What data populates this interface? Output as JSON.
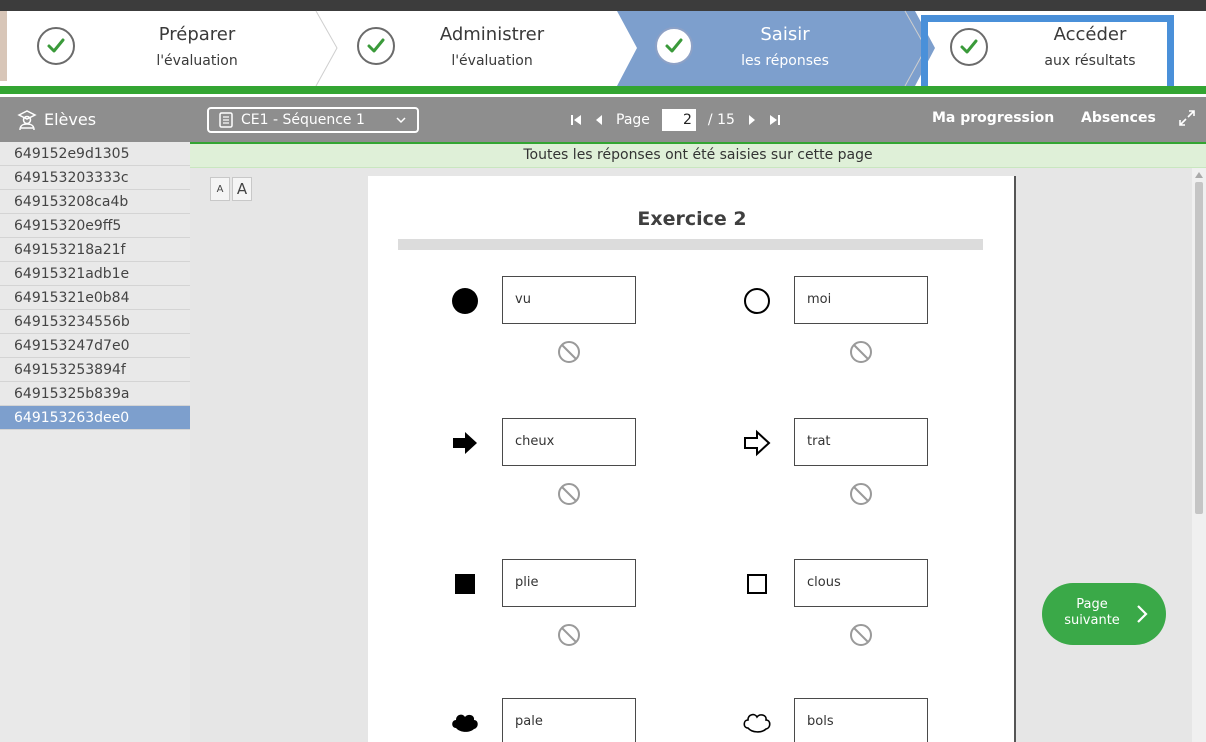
{
  "wizard": {
    "steps": [
      {
        "title": "Préparer",
        "subtitle": "l'évaluation",
        "state": "done"
      },
      {
        "title": "Administrer",
        "subtitle": "l'évaluation",
        "state": "done"
      },
      {
        "title": "Saisir",
        "subtitle": "les réponses",
        "state": "current"
      },
      {
        "title": "Accéder",
        "subtitle": "aux résultats",
        "state": "done"
      }
    ],
    "highlighted_step": "Accéder",
    "colors": {
      "current_step": "#7d9fcd",
      "progress_bar": "#33a532",
      "highlight_border": "#4a90d9"
    }
  },
  "sidebar": {
    "title": "Elèves",
    "icon": "student-icon",
    "students": [
      "649152e9d1305",
      "649153203333c",
      "649153208ca4b",
      "64915320e9ff5",
      "649153218a21f",
      "64915321adb1e",
      "64915321e0b84",
      "649153234556b",
      "649153247d7e0",
      "649153253894f",
      "64915325b839a",
      "649153263dee0"
    ],
    "selected_index": 11,
    "selected_color": "#7d9fcd"
  },
  "toolbar": {
    "sequence": "CE1 - Séquence 1",
    "page_label": "Page",
    "page_current": "2",
    "page_total": "/ 15",
    "progression": "Ma progression",
    "absences": "Absences"
  },
  "banner": {
    "text": "Toutes les réponses ont été saisies sur cette page"
  },
  "font_buttons": {
    "small": "A",
    "large": "A"
  },
  "exercise": {
    "title": "Exercice 2",
    "items": [
      {
        "symbol": "filled-circle-icon",
        "word": "vu"
      },
      {
        "symbol": "outline-circle-icon",
        "word": "moi"
      },
      {
        "symbol": "filled-arrow-icon",
        "word": "cheux"
      },
      {
        "symbol": "outline-arrow-icon",
        "word": "trat"
      },
      {
        "symbol": "filled-square-icon",
        "word": "plie"
      },
      {
        "symbol": "outline-square-icon",
        "word": "clous"
      },
      {
        "symbol": "filled-cloud-icon",
        "word": "pale"
      },
      {
        "symbol": "outline-cloud-icon",
        "word": "bols"
      }
    ]
  },
  "next_button": {
    "line1": "Page",
    "line2": "suivante",
    "color": "#3aa948"
  }
}
